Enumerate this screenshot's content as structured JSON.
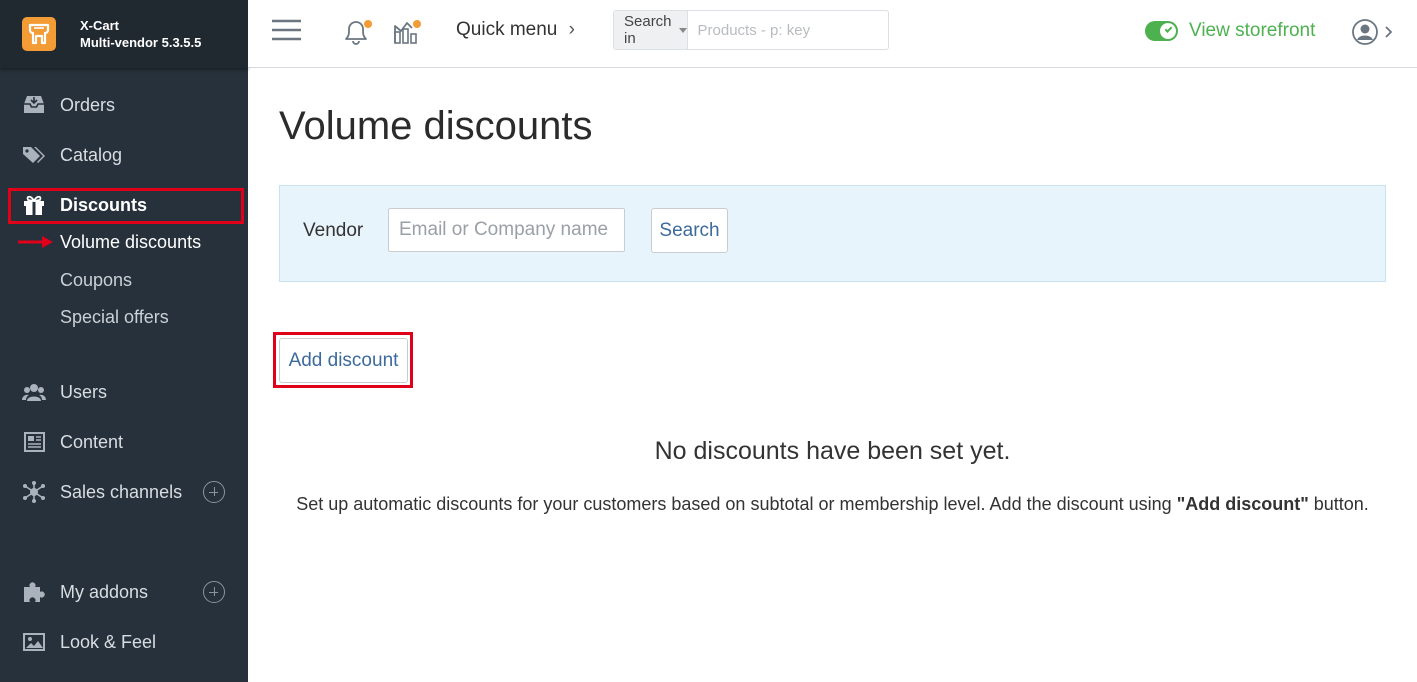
{
  "brand": {
    "name": "X-Cart",
    "edition": "Multi-vendor 5.3.5.5",
    "color": "#f39b34"
  },
  "sidebar": {
    "items": [
      {
        "label": "Orders",
        "icon": "inbox-icon"
      },
      {
        "label": "Catalog",
        "icon": "tags-icon"
      },
      {
        "label": "Discounts",
        "icon": "gift-icon",
        "active": true,
        "sub": [
          {
            "label": "Volume discounts",
            "current": true
          },
          {
            "label": "Coupons"
          },
          {
            "label": "Special offers"
          }
        ]
      },
      {
        "label": "Users",
        "icon": "users-icon"
      },
      {
        "label": "Content",
        "icon": "newspaper-icon"
      },
      {
        "label": "Sales channels",
        "icon": "network-icon",
        "expandable": true
      },
      {
        "label": "My addons",
        "icon": "puzzle-icon",
        "expandable": true
      },
      {
        "label": "Look & Feel",
        "icon": "image-icon"
      }
    ]
  },
  "topbar": {
    "quick_menu": "Quick menu",
    "search_scope": "Search in",
    "search_placeholder": "Products - p: key",
    "view_storefront": "View storefront",
    "storefront_enabled": true,
    "accent_green": "#4db150",
    "notification_dot": "#f39b34"
  },
  "main": {
    "title": "Volume discounts",
    "filter": {
      "vendor_label": "Vendor",
      "vendor_placeholder": "Email or Company name",
      "search_button": "Search"
    },
    "add_button": "Add discount",
    "empty_title": "No discounts have been set yet.",
    "empty_text_before": "Set up automatic discounts for your customers based on subtotal or membership level. Add the discount using ",
    "empty_text_bold": "\"Add discount\"",
    "empty_text_after": " button."
  },
  "highlight_color": "#e0001a"
}
